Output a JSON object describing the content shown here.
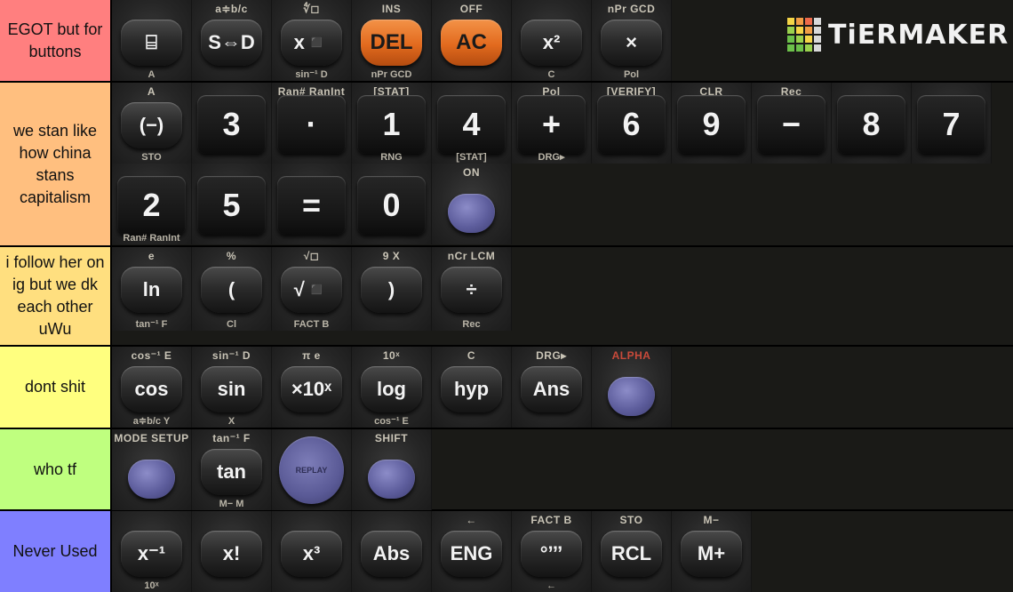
{
  "brand": {
    "name": "TiERMAKER"
  },
  "colors": {
    "tier_s": "#ff7f7f",
    "tier_a": "#ffbf7f",
    "tier_b": "#ffdf7f",
    "tier_c": "#ffff7f",
    "tier_d": "#bfff7f",
    "tier_e": "#7f7fff",
    "logo_cells": [
      "#f5d547",
      "#f29d45",
      "#ee6a4a",
      "#d9d9d9",
      "#9ad14d",
      "#f5d547",
      "#f29d45",
      "#d9d9d9",
      "#6cc04a",
      "#9ad14d",
      "#f5d547",
      "#d9d9d9",
      "#6cc04a",
      "#6cc04a",
      "#9ad14d",
      "#d9d9d9"
    ]
  },
  "tiers": [
    {
      "label": "EGOT but for buttons",
      "items": [
        {
          "sub": "",
          "cap": "⌸",
          "bot": "A"
        },
        {
          "sub": "a≑b/c",
          "cap": "S⇔D",
          "bot": ""
        },
        {
          "sub": "∜◻",
          "cap": "x◾",
          "bot": "sin⁻¹ D"
        },
        {
          "sub": "INS",
          "cap": "DEL",
          "bot": "nPr GCD",
          "style": "orange"
        },
        {
          "sub": "OFF",
          "cap": "AC",
          "bot": "",
          "style": "orange"
        },
        {
          "sub": "",
          "cap": "x²",
          "bot": "C"
        },
        {
          "sub": "nPr GCD",
          "cap": "×",
          "bot": "Pol"
        }
      ]
    },
    {
      "label": "we stan like how china stans capitalism",
      "items": [
        {
          "sub": "A",
          "cap": "(−)",
          "bot": "STO"
        },
        {
          "sub": "",
          "cap": "3",
          "bot": "",
          "style": "num"
        },
        {
          "sub": "Ran# RanInt",
          "cap": "·",
          "bot": "",
          "style": "num"
        },
        {
          "sub": "[STAT]",
          "cap": "1",
          "bot": "RNG",
          "style": "num"
        },
        {
          "sub": "",
          "cap": "4",
          "bot": "[STAT]",
          "style": "num"
        },
        {
          "sub": "Pol",
          "cap": "+",
          "bot": "DRG▸",
          "style": "num"
        },
        {
          "sub": "[VERIFY]",
          "cap": "6",
          "bot": "",
          "style": "num"
        },
        {
          "sub": "CLR",
          "cap": "9",
          "bot": "",
          "style": "num"
        },
        {
          "sub": "Rec",
          "cap": "−",
          "bot": "",
          "style": "num"
        },
        {
          "sub": "",
          "cap": "8",
          "bot": "",
          "style": "num"
        },
        {
          "sub": "",
          "cap": "7",
          "bot": "",
          "style": "num"
        },
        {
          "sub": "",
          "cap": "2",
          "bot": "Ran# RanInt",
          "style": "num"
        },
        {
          "sub": "",
          "cap": "5",
          "bot": "",
          "style": "num"
        },
        {
          "sub": "",
          "cap": "=",
          "bot": "",
          "style": "num"
        },
        {
          "sub": "",
          "cap": "0",
          "bot": "",
          "style": "num"
        },
        {
          "sub": "ON",
          "cap": "",
          "bot": "",
          "style": "blue"
        }
      ]
    },
    {
      "label": "i follow her on ig but we dk each other uWu",
      "items": [
        {
          "sub": "e",
          "cap": "ln",
          "bot": "tan⁻¹ F"
        },
        {
          "sub": "%",
          "cap": "(",
          "bot": "Cl"
        },
        {
          "sub": "√◻",
          "cap": "√◾",
          "bot": "FACT B"
        },
        {
          "sub": "9 X",
          "cap": ")",
          "bot": ""
        },
        {
          "sub": "nCr LCM",
          "cap": "÷",
          "bot": "Rec"
        }
      ]
    },
    {
      "label": "dont shit",
      "items": [
        {
          "sub": "cos⁻¹ E",
          "cap": "cos",
          "bot": "a≑b/c Y"
        },
        {
          "sub": "sin⁻¹ D",
          "cap": "sin",
          "bot": "X"
        },
        {
          "sub": "π e",
          "cap": "×10ˣ",
          "bot": ""
        },
        {
          "sub": "10ˣ",
          "cap": "log",
          "bot": "cos⁻¹ E"
        },
        {
          "sub": "C",
          "cap": "hyp",
          "bot": ""
        },
        {
          "sub": "DRG▸",
          "cap": "Ans",
          "bot": ""
        },
        {
          "sub": "ALPHA",
          "cap": "",
          "bot": "",
          "style": "blue",
          "subred": true
        }
      ]
    },
    {
      "label": "who tf",
      "items": [
        {
          "sub": "MODE SETUP",
          "cap": "",
          "bot": "",
          "style": "blue"
        },
        {
          "sub": "tan⁻¹ F",
          "cap": "tan",
          "bot": "M− M"
        },
        {
          "sub": "",
          "cap": "REPLAY",
          "bot": "",
          "style": "dpad"
        },
        {
          "sub": "SHIFT",
          "cap": "",
          "bot": "",
          "style": "blue"
        }
      ]
    },
    {
      "label": "Never Used",
      "items": [
        {
          "sub": "",
          "cap": "x⁻¹",
          "bot": "10ˣ"
        },
        {
          "sub": "",
          "cap": "x!",
          "bot": ""
        },
        {
          "sub": "",
          "cap": "x³",
          "bot": ""
        },
        {
          "sub": "",
          "cap": "Abs",
          "bot": ""
        },
        {
          "sub": "←",
          "cap": "ENG",
          "bot": ""
        },
        {
          "sub": "FACT B",
          "cap": "°’’’",
          "bot": "←"
        },
        {
          "sub": "STO",
          "cap": "RCL",
          "bot": ""
        },
        {
          "sub": "M−",
          "cap": "M+",
          "bot": ""
        }
      ]
    }
  ]
}
